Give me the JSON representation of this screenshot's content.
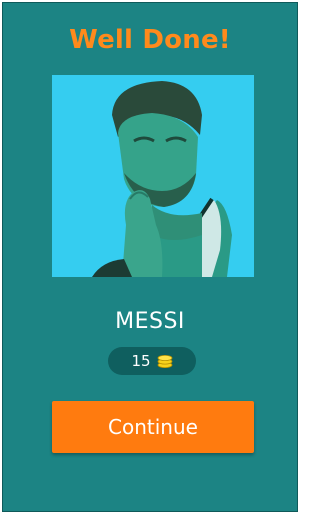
{
  "header": {
    "title": "Well Done!"
  },
  "answer": {
    "name": "MESSI"
  },
  "reward": {
    "amount": "15",
    "icon": "coin-stack-icon"
  },
  "actions": {
    "continue_label": "Continue"
  },
  "colors": {
    "background": "#1c8484",
    "title": "#ff8a1c",
    "photo_tint": "#35cdf0",
    "reward_pill": "#0f5f5f",
    "button": "#ff7b0f",
    "coin": "#f7d21c"
  }
}
